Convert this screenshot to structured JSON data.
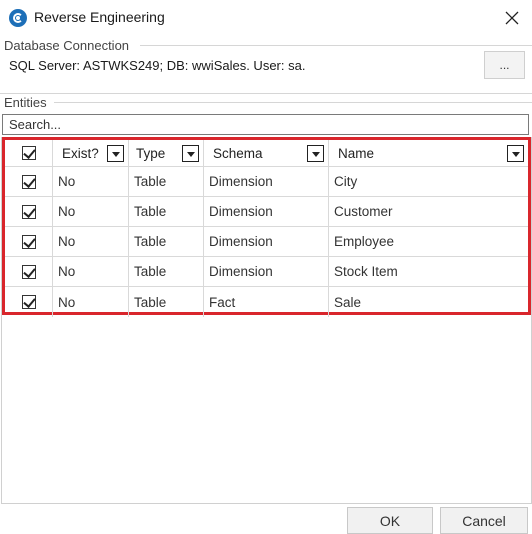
{
  "window": {
    "title": "Reverse Engineering",
    "icon": "app-logo-icon",
    "close_icon": "close-icon"
  },
  "database_connection": {
    "group_label": "Database Connection",
    "connection_text": "SQL Server:  ASTWKS249; DB: wwiSales. User: sa.",
    "browse_button_label": "..."
  },
  "entities": {
    "group_label": "Entities",
    "search": {
      "placeholder": "Search...",
      "value": ""
    },
    "columns": [
      "",
      "Exist?",
      "Type",
      "Schema",
      "Name"
    ],
    "rows": [
      {
        "checked": true,
        "exist": "No",
        "type": "Table",
        "schema": "Dimension",
        "name": "City"
      },
      {
        "checked": true,
        "exist": "No",
        "type": "Table",
        "schema": "Dimension",
        "name": "Customer"
      },
      {
        "checked": true,
        "exist": "No",
        "type": "Table",
        "schema": "Dimension",
        "name": "Employee"
      },
      {
        "checked": true,
        "exist": "No",
        "type": "Table",
        "schema": "Dimension",
        "name": "Stock Item"
      },
      {
        "checked": true,
        "exist": "No",
        "type": "Table",
        "schema": "Fact",
        "name": "Sale"
      }
    ],
    "highlight_color": "#d9262c"
  },
  "footer": {
    "ok_label": "OK",
    "cancel_label": "Cancel"
  }
}
